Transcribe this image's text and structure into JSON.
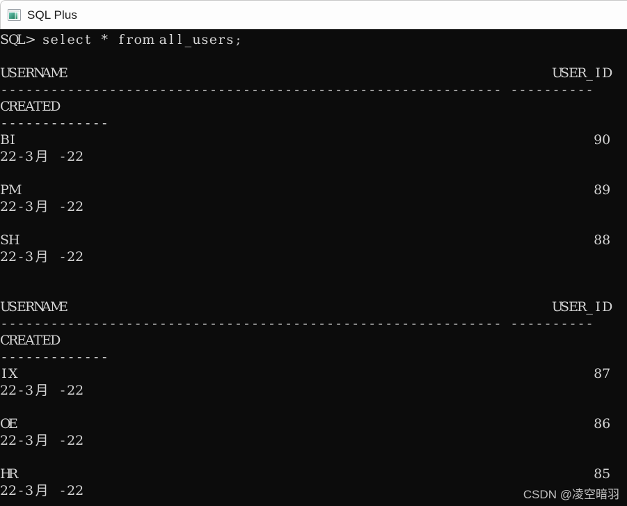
{
  "window": {
    "title": "SQL Plus",
    "icon": "sqlplus-window-icon",
    "titlebar_bg": "#fdfdfd",
    "terminal_bg": "#0c0c0c",
    "terminal_fg": "#d4d4d4"
  },
  "terminal": {
    "prompt": "SQL>",
    "command": "select * from all_users;",
    "prompt_line": "SQL> select * from all_users;",
    "columns": {
      "username_header": "USERNAME",
      "user_id_header": "USER_ID",
      "created_header": "CREATED",
      "username_rule": "------------------------------------------------------------",
      "user_id_rule": "----------",
      "created_rule": "-------------"
    },
    "blocks": [
      {
        "header_line": "USERNAME                                                          USER_ID",
        "rule_line": "------------------------------------------------------------ ----------",
        "created_header_line": "CREATED",
        "created_rule_line": "-------------",
        "rows": [
          {
            "username": "BI",
            "user_id": "90",
            "created": "22-3月 -22"
          },
          {
            "username": "PM",
            "user_id": "89",
            "created": "22-3月 -22"
          },
          {
            "username": "SH",
            "user_id": "88",
            "created": "22-3月 -22"
          }
        ]
      },
      {
        "header_line": "USERNAME                                                          USER_ID",
        "rule_line": "------------------------------------------------------------ ----------",
        "created_header_line": "CREATED",
        "created_rule_line": "-------------",
        "rows": [
          {
            "username": "IX",
            "user_id": "87",
            "created": "22-3月 -22"
          },
          {
            "username": "OE",
            "user_id": "86",
            "created": "22-3月 -22"
          },
          {
            "username": "HR",
            "user_id": "85",
            "created": "22-3月 -22"
          }
        ]
      }
    ]
  },
  "watermark": {
    "text": "CSDN @凌空暗羽"
  }
}
